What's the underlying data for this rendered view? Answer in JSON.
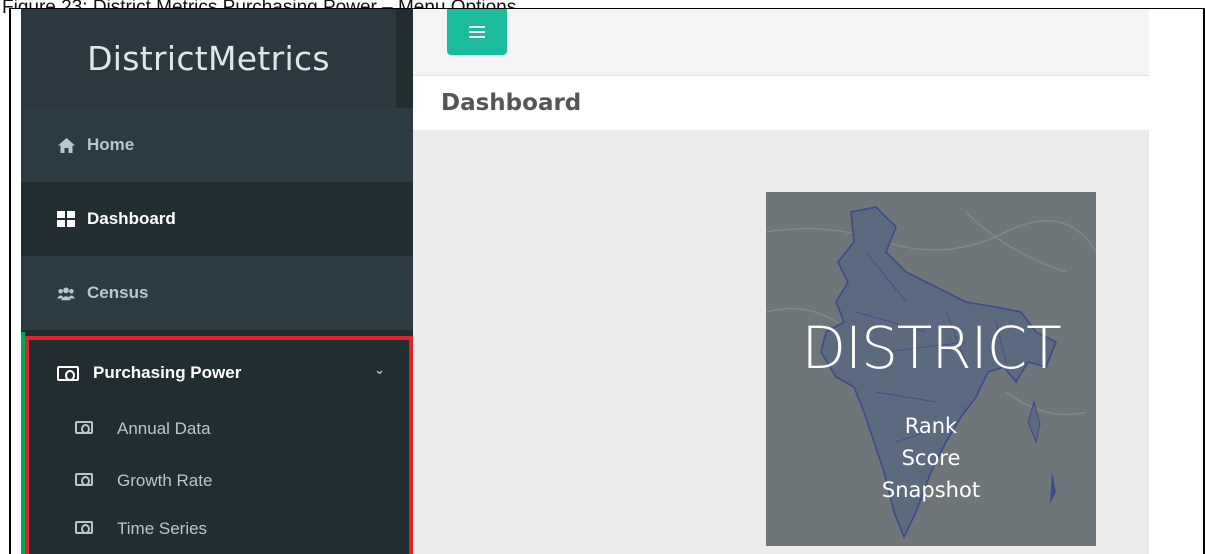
{
  "caption": "Figure 23: District Metrics Purchasing Power – Menu Options",
  "brand": "DistrictMetrics",
  "nav": {
    "home": {
      "label": "Home",
      "icon": "home-icon"
    },
    "dashboard": {
      "label": "Dashboard",
      "icon": "dashboard-icon"
    },
    "census": {
      "label": "Census",
      "icon": "users-icon"
    },
    "purchasing_power": {
      "label": "Purchasing Power",
      "icon": "money-icon",
      "expanded": true,
      "children": [
        {
          "label": "Annual Data",
          "icon": "money-icon"
        },
        {
          "label": "Growth Rate",
          "icon": "money-icon"
        },
        {
          "label": "Time Series",
          "icon": "money-icon"
        }
      ]
    }
  },
  "header": {
    "title": "Dashboard"
  },
  "card": {
    "title": "DISTRICT",
    "lines": [
      "Rank",
      "Score",
      "Snapshot"
    ]
  },
  "colors": {
    "sidebar": "#222d32",
    "accent_green": "#00a65a",
    "menu_button": "#1abc9c",
    "highlight": "#e0242e"
  }
}
